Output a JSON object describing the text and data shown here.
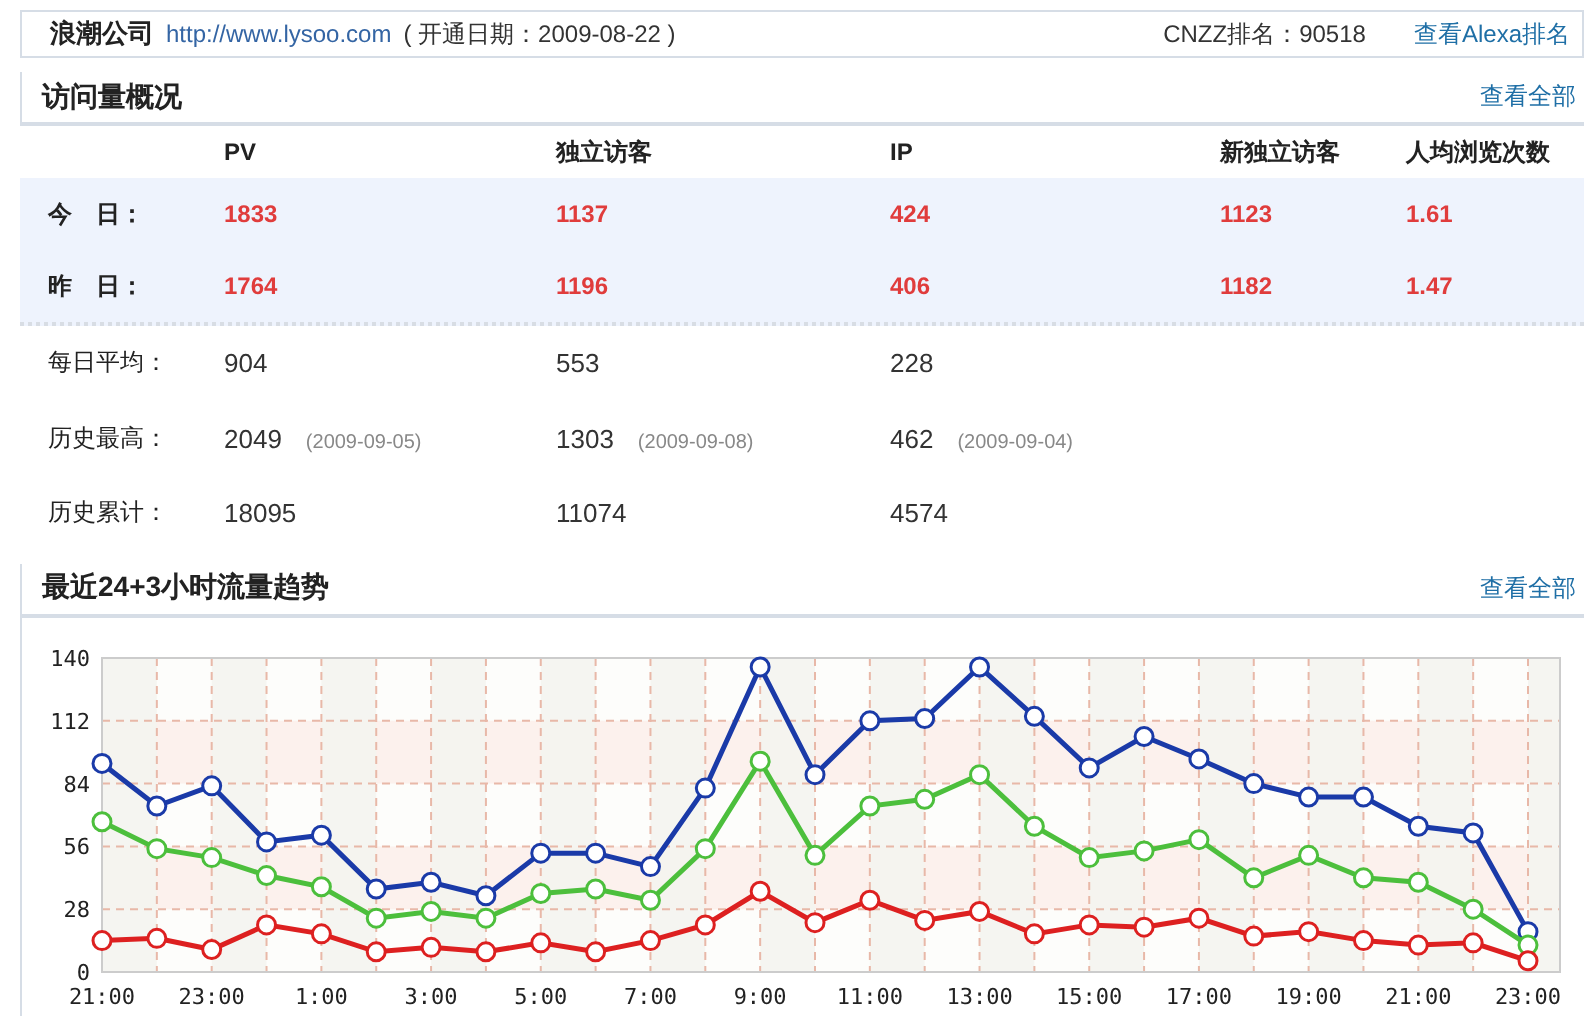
{
  "header": {
    "company": "浪潮公司",
    "url": "http://www.lysoo.com",
    "open_date": "( 开通日期：2009-08-22 )",
    "rank": "CNZZ排名：90518",
    "alexa_link": "查看Alexa排名"
  },
  "overview": {
    "title": "访问量概况",
    "view_all": "查看全部",
    "columns": [
      "PV",
      "独立访客",
      "IP",
      "新独立访客",
      "人均浏览次数"
    ],
    "rows": [
      {
        "kind": "highlight",
        "label": "今　日：",
        "cells": [
          {
            "value": "1833"
          },
          {
            "value": "1137"
          },
          {
            "value": "424"
          },
          {
            "value": "1123"
          },
          {
            "value": "1.61"
          }
        ]
      },
      {
        "kind": "highlight",
        "label": "昨　日：",
        "cells": [
          {
            "value": "1764"
          },
          {
            "value": "1196"
          },
          {
            "value": "406"
          },
          {
            "value": "1182"
          },
          {
            "value": "1.47"
          }
        ]
      },
      {
        "kind": "plain",
        "label": "每日平均：",
        "cells": [
          {
            "value": "904"
          },
          {
            "value": "553"
          },
          {
            "value": "228"
          }
        ]
      },
      {
        "kind": "plain",
        "label": "历史最高：",
        "cells": [
          {
            "value": "2049",
            "date": "(2009-09-05)"
          },
          {
            "value": "1303",
            "date": "(2009-09-08)"
          },
          {
            "value": "462",
            "date": "(2009-09-04)"
          }
        ]
      },
      {
        "kind": "plain",
        "label": "历史累计：",
        "cells": [
          {
            "value": "18095"
          },
          {
            "value": "11074"
          },
          {
            "value": "4574"
          }
        ]
      }
    ]
  },
  "trend": {
    "title": "最近24+3小时流量趋势",
    "view_all": "查看全部",
    "chart_data": {
      "type": "line",
      "categories": [
        "21:00",
        null,
        "23:00",
        null,
        "1:00",
        null,
        "3:00",
        null,
        "5:00",
        null,
        "7:00",
        null,
        "9:00",
        null,
        "11:00",
        null,
        "13:00",
        null,
        "15:00",
        null,
        "17:00",
        null,
        "19:00",
        null,
        "21:00",
        null,
        "23:00"
      ],
      "grid": true,
      "ylim": [
        0,
        140
      ],
      "yticks": [
        0,
        28,
        56,
        84,
        112,
        140
      ],
      "series": [
        {
          "color": "#1a3aa8",
          "marker": "circle",
          "values": [
            93,
            74,
            83,
            58,
            61,
            37,
            40,
            34,
            53,
            53,
            47,
            82,
            136,
            88,
            112,
            113,
            136,
            114,
            91,
            105,
            95,
            84,
            78,
            78,
            65,
            62,
            18
          ]
        },
        {
          "color": "#4cbf3c",
          "marker": "circle",
          "values": [
            67,
            55,
            51,
            43,
            38,
            24,
            27,
            24,
            35,
            37,
            32,
            55,
            94,
            52,
            74,
            77,
            88,
            65,
            51,
            54,
            59,
            42,
            52,
            42,
            40,
            28,
            12
          ]
        },
        {
          "color": "#dd2020",
          "marker": "circle",
          "values": [
            14,
            15,
            10,
            21,
            17,
            9,
            11,
            9,
            13,
            9,
            14,
            21,
            36,
            22,
            32,
            23,
            27,
            17,
            21,
            20,
            24,
            16,
            18,
            14,
            12,
            13,
            5
          ]
        }
      ]
    }
  }
}
